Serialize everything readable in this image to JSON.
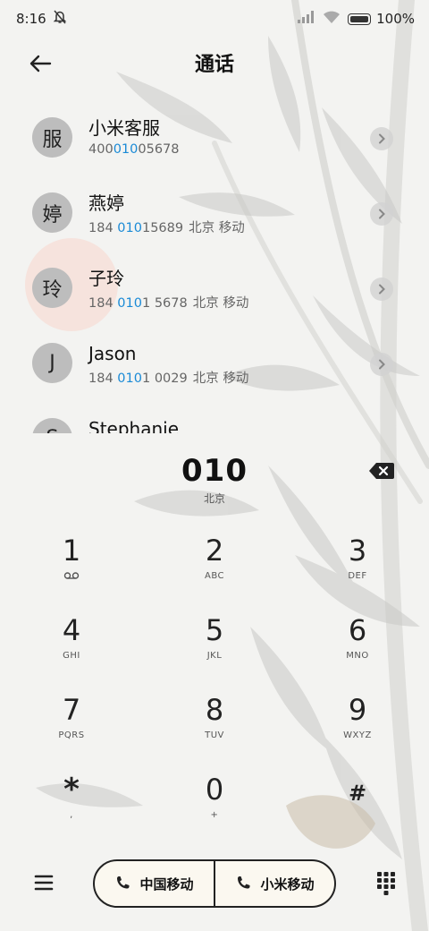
{
  "status_bar": {
    "time": "8:16",
    "battery": "100%",
    "icons": [
      "mute-bell-icon",
      "signal-icon",
      "wifi-icon",
      "battery-icon"
    ]
  },
  "header": {
    "title": "通话",
    "back_icon": "arrow-left-icon"
  },
  "contacts": [
    {
      "avatar": "服",
      "name": "小米客服",
      "num_pre": "400",
      "num_hl": "010",
      "num_post": "05678",
      "location": ""
    },
    {
      "avatar": "婷",
      "name": "燕婷",
      "num_pre": "184 ",
      "num_hl": "010",
      "num_post": "15689",
      "location": "北京 移动"
    },
    {
      "avatar": "玲",
      "name": "子玲",
      "num_pre": "184 ",
      "num_hl": "010",
      "num_post": "1 5678",
      "location": "北京 移动"
    },
    {
      "avatar": "J",
      "name": "Jason",
      "num_pre": "184 ",
      "num_hl": "010",
      "num_post": "1 0029",
      "location": "北京 移动"
    },
    {
      "avatar": "S",
      "name": "Stephanie",
      "num_pre": "",
      "num_hl": "",
      "num_post": "",
      "location": ""
    }
  ],
  "dialer": {
    "number": "010",
    "region": "北京",
    "keys": [
      {
        "digit": "1",
        "letters": "",
        "icon": "voicemail-icon"
      },
      {
        "digit": "2",
        "letters": "ABC"
      },
      {
        "digit": "3",
        "letters": "DEF"
      },
      {
        "digit": "4",
        "letters": "GHI"
      },
      {
        "digit": "5",
        "letters": "JKL"
      },
      {
        "digit": "6",
        "letters": "MNO"
      },
      {
        "digit": "7",
        "letters": "PQRS"
      },
      {
        "digit": "8",
        "letters": "TUV"
      },
      {
        "digit": "9",
        "letters": "WXYZ"
      },
      {
        "digit": "*",
        "letters": ","
      },
      {
        "digit": "0",
        "letters": "+"
      },
      {
        "digit": "#",
        "letters": ""
      }
    ]
  },
  "bottom": {
    "sim1_label": "中国移动",
    "sim1_index": "1",
    "sim2_label": "小米移动",
    "sim2_index": "2"
  },
  "colors": {
    "highlight": "#1a8ad6",
    "avatar_bg": "#bdbdbd",
    "text": "#1a1a1a"
  }
}
